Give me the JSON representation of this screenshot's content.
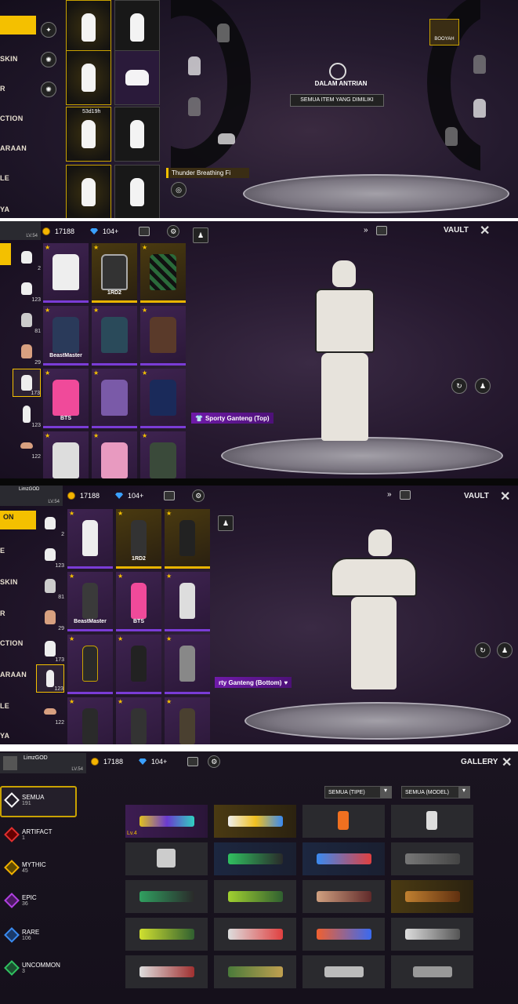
{
  "panel1": {
    "nav": [
      "SKIN",
      "R",
      "CTION",
      "ARAAN",
      "LE",
      "YA"
    ],
    "emote_label": "Thunder Breathing Fi",
    "queue_status": "DALAM ANTRIAN",
    "owned_button": "SEMUA ITEM YANG DIMILIKI",
    "timer": "53d19h",
    "wheel_label": "BOOYAH"
  },
  "panel2": {
    "level": "LV.54",
    "coins": "17188",
    "diamonds": "104+",
    "title": "VAULT",
    "categories": [
      {
        "count": "2"
      },
      {
        "count": "123"
      },
      {
        "count": "81"
      },
      {
        "count": "29"
      },
      {
        "count": "173"
      },
      {
        "count": "123"
      },
      {
        "count": "122"
      }
    ],
    "tile_labels": [
      "1RD2",
      "BeastMaster",
      "BTS"
    ],
    "item_name": "Sporty Ganteng (Top)"
  },
  "panel3": {
    "user": "LimzGOD",
    "level": "LV.54",
    "coins": "17188",
    "diamonds": "104+",
    "title": "VAULT",
    "nav": [
      "ON",
      "E",
      "SKIN",
      "R",
      "CTION",
      "ARAAN",
      "LE",
      "YA"
    ],
    "categories": [
      {
        "count": "2"
      },
      {
        "count": "123"
      },
      {
        "count": "81"
      },
      {
        "count": "29"
      },
      {
        "count": "173"
      },
      {
        "count": "123"
      },
      {
        "count": "122"
      }
    ],
    "tile_labels": [
      "1RD2",
      "BeastMaster",
      "BTS"
    ],
    "item_name": "rty Ganteng (Bottom)"
  },
  "panel4": {
    "user": "LimzGOD",
    "level": "LV.54",
    "coins": "17188",
    "diamonds": "104+",
    "title": "GALLERY",
    "filter_type": "SEMUA (TIPE)",
    "filter_model": "SEMUA (MODEL)",
    "weapon_level": "Lv.4",
    "rarities": [
      {
        "name": "SEMUA",
        "count": "191",
        "color": "#ffffff"
      },
      {
        "name": "ARTIFACT",
        "count": "1",
        "color": "#e03030"
      },
      {
        "name": "MYTHIC",
        "count": "45",
        "color": "#f0b000"
      },
      {
        "name": "EPIC",
        "count": "36",
        "color": "#b040e0"
      },
      {
        "name": "RARE",
        "count": "106",
        "color": "#3a8af0"
      },
      {
        "name": "UNCOMMON",
        "count": "3",
        "color": "#30c060"
      }
    ]
  }
}
